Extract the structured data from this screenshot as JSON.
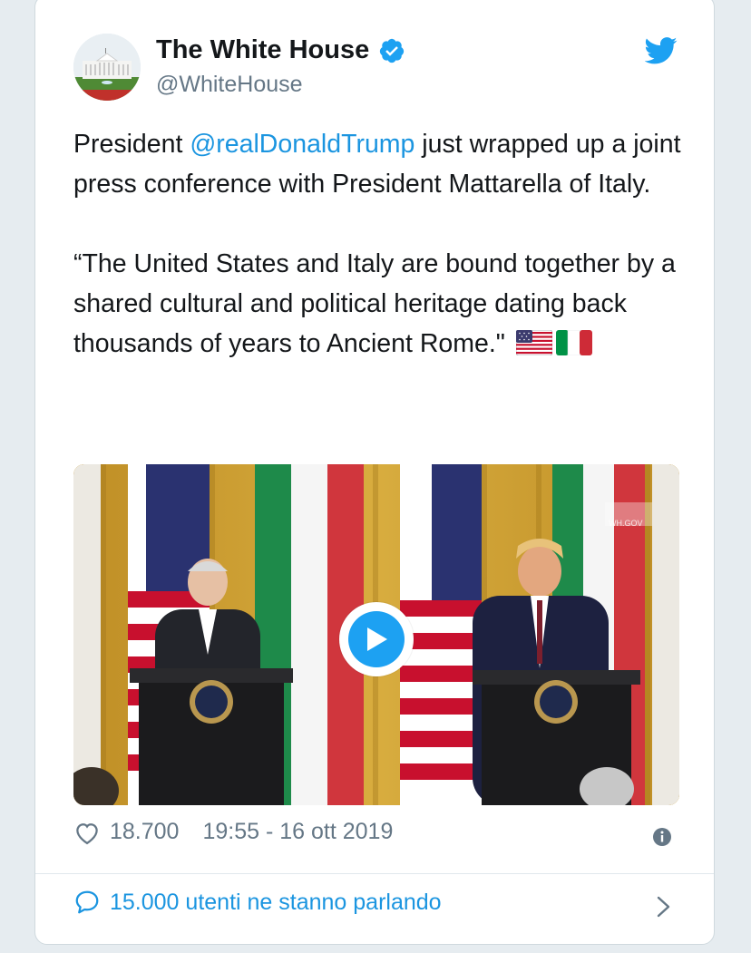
{
  "tweet": {
    "author": {
      "name": "The White House",
      "handle": "@WhiteHouse",
      "verified": true
    },
    "text": {
      "p1_before": "President ",
      "p1_mention": "@realDonaldTrump",
      "p1_after": " just wrapped up a joint press conference with President Mattarella of Italy.",
      "p2": "“The United States and Italy are bound together by a shared cultural and political heritage dating back thousands of years to Ancient Rome.\""
    },
    "flags": [
      "us-flag-icon",
      "italy-flag-icon"
    ],
    "media": {
      "type": "video",
      "watermark": "WH.GOV"
    },
    "stats": {
      "likes": "18.700",
      "timestamp": "19:55 - 16 ott 2019"
    },
    "conversation": {
      "label": "15.000 utenti ne stanno parlando"
    }
  },
  "colors": {
    "accent": "#1da1f2",
    "link": "#1b95e0",
    "text": "#14171a",
    "secondary": "#657786",
    "border": "#e1e8ed"
  }
}
